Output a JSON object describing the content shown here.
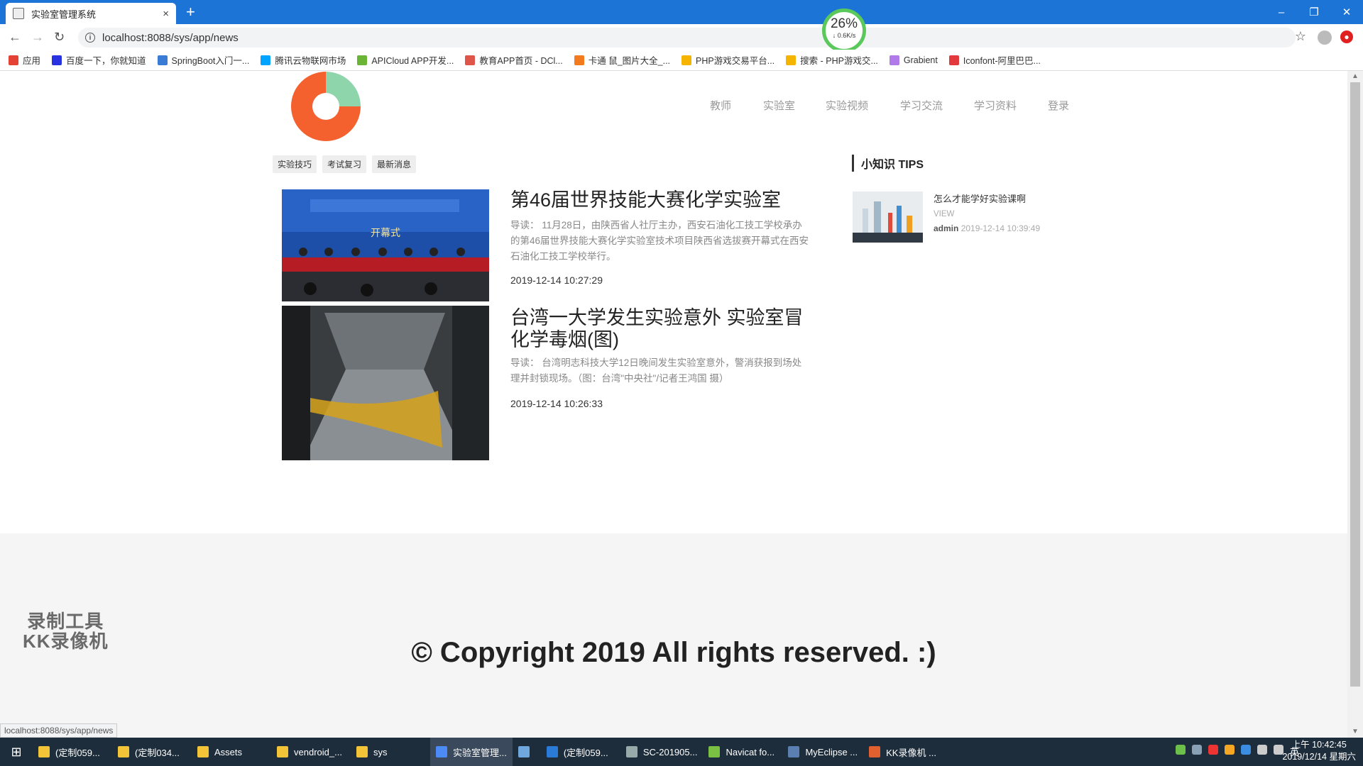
{
  "browser": {
    "tab_title": "实验室管理系统",
    "tab_close": "×",
    "new_tab": "+",
    "url": "localhost:8088/sys/app/news",
    "status_url": "localhost:8088/sys/app/news",
    "speed_percent": "26%",
    "speed_rate": "↓ 0.6K/s",
    "window_controls": {
      "minimize": "–",
      "restore": "❐",
      "close": "✕"
    },
    "bookmarks": [
      {
        "label": "应用",
        "color": "#e34234"
      },
      {
        "label": "百度一下，你就知道",
        "color": "#2932e1"
      },
      {
        "label": "SpringBoot入门一...",
        "color": "#3a7bd5"
      },
      {
        "label": "腾讯云物联网市场",
        "color": "#00a3ff"
      },
      {
        "label": "APICloud APP开发...",
        "color": "#6bb536"
      },
      {
        "label": "教育APP首页 - DCl...",
        "color": "#e0554a"
      },
      {
        "label": "卡通 鼠_图片大全_...",
        "color": "#f37b1d"
      },
      {
        "label": "PHP游戏交易平台...",
        "color": "#f5b400"
      },
      {
        "label": "搜索 - PHP游戏交...",
        "color": "#f5b400"
      },
      {
        "label": "Grabient",
        "color": "#b07be8"
      },
      {
        "label": "Iconfont-阿里巴巴...",
        "color": "#e4393c"
      }
    ]
  },
  "site": {
    "nav": [
      "教师",
      "实验室",
      "实验视频",
      "学习交流",
      "学习资料",
      "登录"
    ],
    "categories": [
      "实验技巧",
      "考试复习",
      "最新消息"
    ],
    "articles": [
      {
        "title": "第46届世界技能大赛化学实验室",
        "excerpt": "导读：  11月28日，由陕西省人社厅主办，西安石油化工技工学校承办的第46届世界技能大赛化学实验室技术项目陕西省选拔赛开幕式在西安石油化工技工学校举行。",
        "date": "2019-12-14 10:27:29",
        "banner_text": "开幕式"
      },
      {
        "title": "台湾一大学发生实验意外 实验室冒化学毒烟(图)",
        "excerpt": "导读：  台湾明志科技大学12日晚间发生实验室意外，警消获报到场处理并封锁现场。（图：台湾\"中央社\"/记者王鸿国 摄）",
        "date": "2019-12-14 10:26:33"
      }
    ],
    "sidebar": {
      "heading": "小知识 TIPS",
      "tips": [
        {
          "title": "怎么才能学好实验课啊",
          "view": "VIEW",
          "author": "admin",
          "date": "2019-12-14 10:39:49"
        }
      ]
    },
    "footer": {
      "copyright": "© Copyright 2019 All rights reserved. :)"
    },
    "watermark": [
      "录制工具",
      "KK录像机"
    ]
  },
  "taskbar": {
    "items": [
      {
        "label": "(定制059...",
        "icon": "folder-icon"
      },
      {
        "label": "(定制034...",
        "icon": "folder-icon"
      },
      {
        "label": "Assets",
        "icon": "folder-icon"
      },
      {
        "label": "vendroid_...",
        "icon": "folder-icon"
      },
      {
        "label": "sys",
        "icon": "folder-icon"
      },
      {
        "label": "实验室管理...",
        "icon": "chrome-icon"
      },
      {
        "label": "",
        "icon": "app-icon"
      },
      {
        "label": "(定制059...",
        "icon": "vscode-icon"
      },
      {
        "label": "SC-201905...",
        "icon": "remote-desktop-icon"
      },
      {
        "label": "Navicat fo...",
        "icon": "navicat-icon"
      },
      {
        "label": "MyEclipse ...",
        "icon": "myeclipse-icon"
      },
      {
        "label": "KK录像机 ...",
        "icon": "kk-recorder-icon"
      }
    ],
    "ime": "英",
    "time": "上午 10:42:45",
    "date": "2019/12/14 星期六"
  },
  "colors": {
    "tabbar": "#1c74d6",
    "logo_orange": "#f4612f",
    "logo_green": "#8fd5ab"
  }
}
